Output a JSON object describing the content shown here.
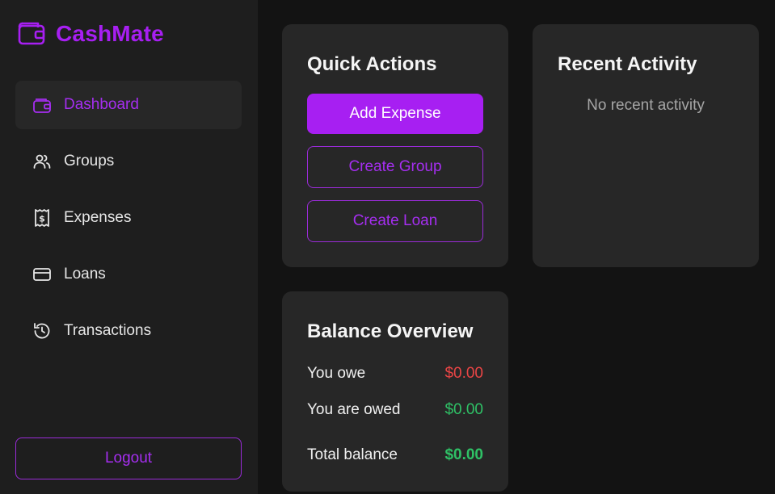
{
  "brand": {
    "name": "CashMate",
    "icon": "wallet-icon",
    "color": "#a71ff2"
  },
  "sidebar": {
    "items": [
      {
        "label": "Dashboard",
        "icon": "wallet-icon",
        "active": true
      },
      {
        "label": "Groups",
        "icon": "users-icon"
      },
      {
        "label": "Expenses",
        "icon": "receipt-icon"
      },
      {
        "label": "Loans",
        "icon": "credit-card-icon"
      },
      {
        "label": "Transactions",
        "icon": "history-icon"
      }
    ],
    "logout_label": "Logout"
  },
  "quick_actions": {
    "title": "Quick Actions",
    "add_expense_label": "Add Expense",
    "create_group_label": "Create Group",
    "create_loan_label": "Create Loan"
  },
  "recent_activity": {
    "title": "Recent Activity",
    "empty_text": "No recent activity"
  },
  "balance_overview": {
    "title": "Balance Overview",
    "you_owe_label": "You owe",
    "you_owe_value": "$0.00",
    "you_are_owed_label": "You are owed",
    "you_are_owed_value": "$0.00",
    "total_label": "Total balance",
    "total_value": "$0.00"
  },
  "colors": {
    "accent": "#a71ff2",
    "negative": "#e94545",
    "positive": "#2fc166"
  }
}
